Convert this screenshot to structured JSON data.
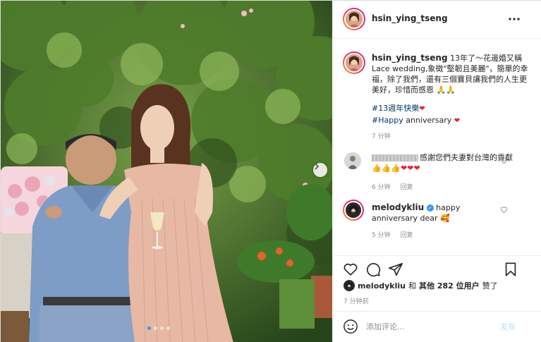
{
  "header": {
    "username": "hsin_ying_tseng",
    "more_icon": "more-horizontal-icon"
  },
  "caption": {
    "username": "hsin_ying_tseng",
    "text": "13年了～花邊婚又稱Lace wedding,象徵\"堅韌且美麗\"，簡單的幸福，除了我們，還有三個寶貝讓我們的人生更美好，珍惜而感恩",
    "emoji": "🙏🙏",
    "hashtag1": "#13週年快樂",
    "hashtag2": "#Happy",
    "hashtag2_rest": " anniversary",
    "heart": "❤",
    "time": "7 分钟"
  },
  "comment1": {
    "username": "",
    "text": "感謝您們夫妻對台灣的貢獻",
    "emoji": "👍👍👍❤❤❤",
    "time": "6 分钟",
    "reply": "回复"
  },
  "comment2": {
    "username": "melodykliu",
    "verified": "✓",
    "text": "happy anniversary dear",
    "emoji": "🥰",
    "time": "5 分钟",
    "reply": "回复"
  },
  "likes": {
    "user": "melodykliu",
    "and": "和",
    "others": "其他 282 位用户",
    "suffix": "赞了"
  },
  "post_time": "7 分钟前",
  "add_comment": {
    "placeholder": "添加评论...",
    "post_label": "发布"
  },
  "carousel": {
    "slides": 4,
    "active": 1
  },
  "colors": {
    "link": "#00376b",
    "verified": "#3897f0",
    "heart": "#e0243c",
    "muted": "#8e8e8e",
    "post_button": "#b2dffc"
  },
  "icons": [
    "heart-icon",
    "comment-icon",
    "share-icon",
    "bookmark-icon",
    "emoji-icon",
    "chevron-right-icon",
    "verified-icon"
  ]
}
